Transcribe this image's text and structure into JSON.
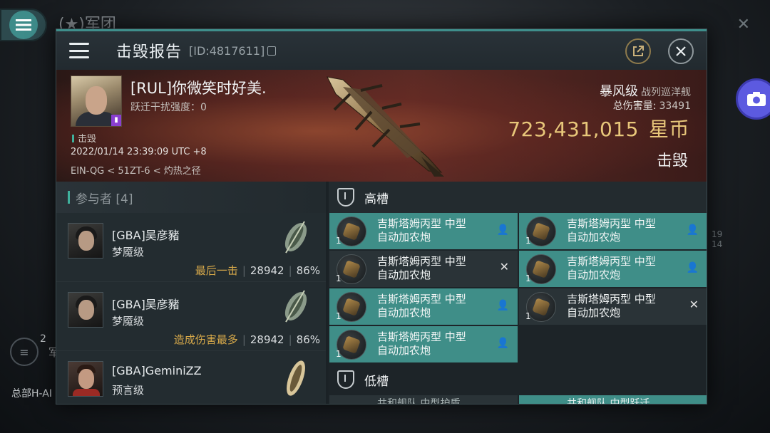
{
  "background": {
    "title": "(★)军团",
    "count": "2",
    "label": "军",
    "hq_text": "总部H-AI",
    "side_nums": [
      "19",
      "14"
    ]
  },
  "header": {
    "title": "击毁报告",
    "id": "[ID:4817611]"
  },
  "victim": {
    "name": "[RUL]你微笑时好美.",
    "jump_interference": "跃迁干扰强度：0",
    "status_tag": "击毁",
    "time": "2022/01/14 23:39:09 UTC +8",
    "location": "EIN-QG < 51ZT-6 < 灼热之径",
    "ship_class": "暴风级",
    "ship_type": "战列巡洋舰",
    "total_damage_label": "总伤害量:",
    "total_damage": "33491",
    "isk_value": "723,431,015",
    "isk_unit": "星币",
    "result": "击毁"
  },
  "participants": {
    "header": "参与者 [4]",
    "items": [
      {
        "name": "[GBA]吴彦豬",
        "ship": "梦魇级",
        "tag": "最后一击",
        "damage": "28942",
        "percent": "86%"
      },
      {
        "name": "[GBA]吴彦豬",
        "ship": "梦魇级",
        "tag": "造成伤害最多",
        "damage": "28942",
        "percent": "86%"
      },
      {
        "name": "[GBA]GeminiZZ",
        "ship": "预言级",
        "tag": "",
        "damage": "",
        "percent": ""
      }
    ]
  },
  "fitting": {
    "high_slot_label": "高槽",
    "low_slot_label": "低槽",
    "high_modules": [
      {
        "name": "吉斯塔姆丙型 中型 自动加农炮",
        "qty": "1",
        "state": "online"
      },
      {
        "name": "吉斯塔姆丙型 中型 自动加农炮",
        "qty": "1",
        "state": "online"
      },
      {
        "name": "吉斯塔姆丙型 中型 自动加农炮",
        "qty": "1",
        "state": "offline"
      },
      {
        "name": "吉斯塔姆丙型 中型 自动加农炮",
        "qty": "1",
        "state": "online"
      },
      {
        "name": "吉斯塔姆丙型 中型 自动加农炮",
        "qty": "1",
        "state": "online"
      },
      {
        "name": "吉斯塔姆丙型 中型 自动加农炮",
        "qty": "1",
        "state": "offline"
      },
      {
        "name": "吉斯塔姆丙型 中型 自动加农炮",
        "qty": "1",
        "state": "online"
      }
    ],
    "low_preview": [
      "共和舰队 中型护盾",
      "共和舰队 中型跃迁"
    ]
  },
  "colors": {
    "accent": "#3f8e88",
    "isk": "#e8c77a",
    "tag": "#d7a94a"
  }
}
